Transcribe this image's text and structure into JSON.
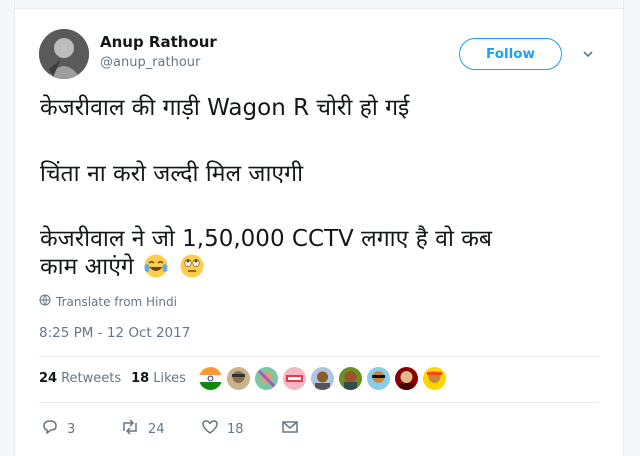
{
  "user": {
    "name": "Anup Rathour",
    "handle": "@anup_rathour"
  },
  "follow_label": "Follow",
  "tweet": {
    "lines": [
      "केजरीवाल की गाड़ी Wagon R चोरी हो गई",
      "चिंता ना करो जल्दी मिल जाएगी",
      "केजरीवाल ने जो 1,50,000 CCTV लगाए है वो कब",
      "काम आएंगे"
    ],
    "emojis": [
      "face-with-tears-of-joy",
      "face-with-rolling-eyes"
    ]
  },
  "translate_label": "Translate from Hindi",
  "timestamp": "8:25 PM - 12 Oct 2017",
  "stats": {
    "retweets_count": "24",
    "retweets_label": "Retweets",
    "likes_count": "18",
    "likes_label": "Likes"
  },
  "liker_avatars": [
    "avatar-1",
    "avatar-2",
    "avatar-3",
    "avatar-4",
    "avatar-5",
    "avatar-6",
    "avatar-7",
    "avatar-8",
    "avatar-9"
  ],
  "actions": {
    "reply_count": "3",
    "retweet_count": "24",
    "like_count": "18"
  },
  "colors": {
    "accent": "#1da1f2",
    "secondary_text": "#657786",
    "divider": "#e6ecf0"
  }
}
